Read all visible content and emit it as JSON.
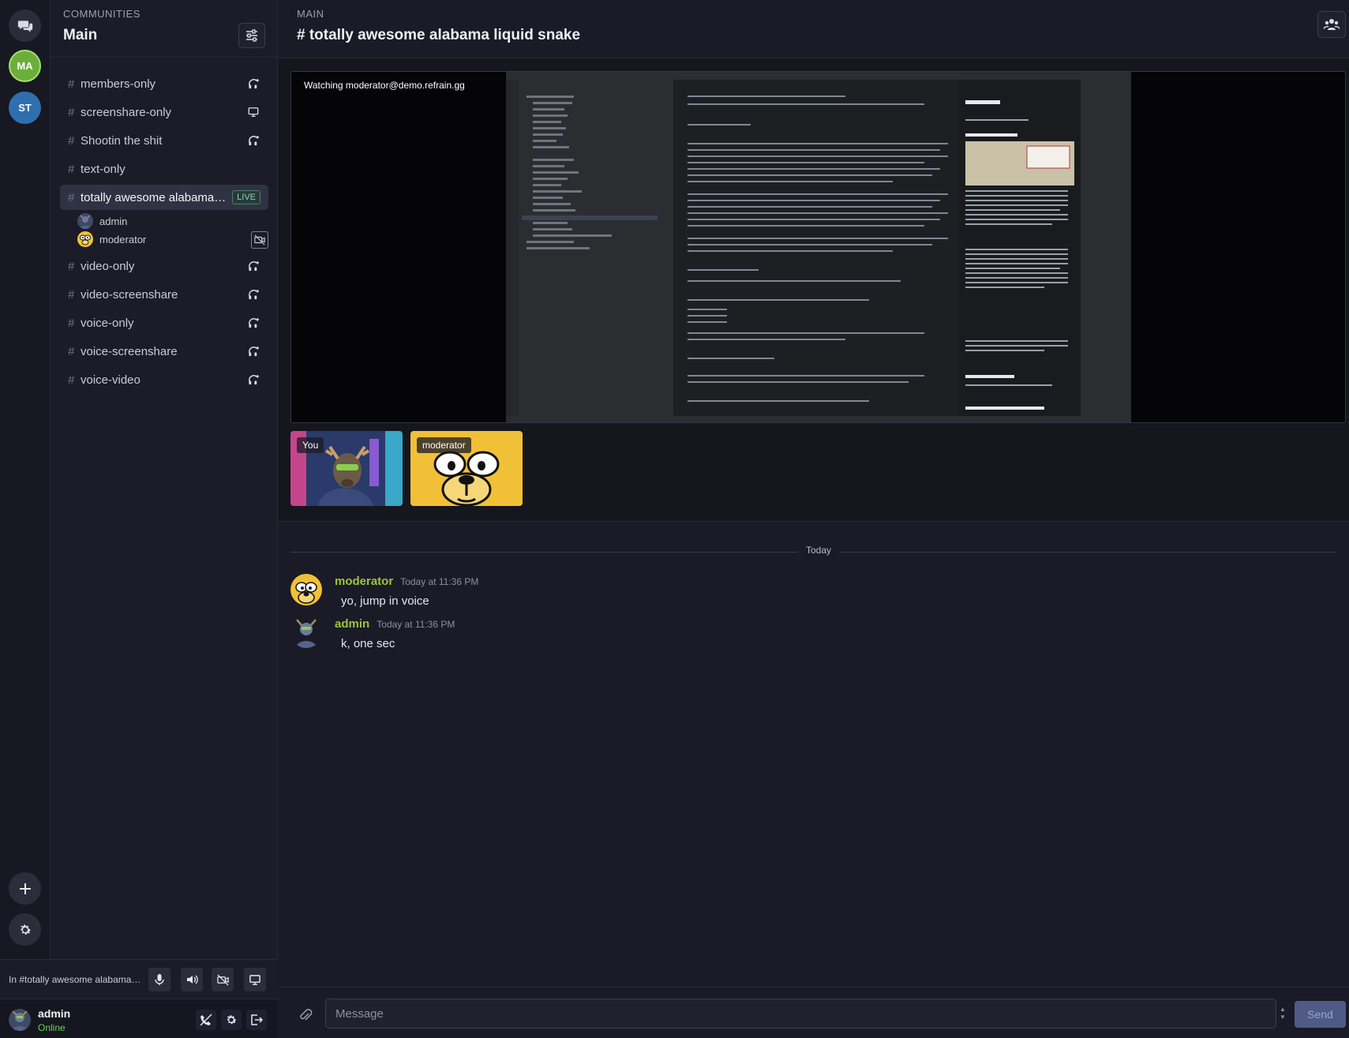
{
  "communities": {
    "label": "COMMUNITIES",
    "items": [
      {
        "initials": "MA",
        "color": "#6cae3a"
      },
      {
        "initials": "ST",
        "color": "#2f6fae"
      }
    ]
  },
  "sidebar": {
    "community_name": "Main",
    "channels": [
      {
        "name": "members-only",
        "icon": "headset-add-icon"
      },
      {
        "name": "screenshare-only",
        "icon": "monitor-icon"
      },
      {
        "name": "Shootin the shit",
        "icon": "headset-add-icon"
      },
      {
        "name": "text-only",
        "icon": ""
      },
      {
        "name": "totally awesome alabama liquid snake",
        "icon": "",
        "badge": "LIVE",
        "active": true
      },
      {
        "name": "video-only",
        "icon": "headset-add-icon"
      },
      {
        "name": "video-screenshare",
        "icon": "headset-add-icon"
      },
      {
        "name": "voice-only",
        "icon": "headset-add-icon"
      },
      {
        "name": "voice-screenshare",
        "icon": "headset-add-icon"
      },
      {
        "name": "voice-video",
        "icon": "headset-add-icon"
      }
    ],
    "voice_members": [
      {
        "name": "admin"
      },
      {
        "name": "moderator"
      }
    ]
  },
  "voice_status": {
    "text": "In #totally awesome alabama liquid snake"
  },
  "user": {
    "name": "admin",
    "status": "Online"
  },
  "main": {
    "kicker": "MAIN",
    "channel_title": "# totally awesome alabama liquid snake",
    "stream": {
      "watching_text": "Watching moderator@demo.refrain.gg"
    },
    "participants": [
      {
        "label": "You"
      },
      {
        "label": "moderator"
      }
    ],
    "divider_label": "Today",
    "messages": [
      {
        "author": "moderator",
        "time": "Today at 11:36 PM",
        "text": "yo, jump in voice"
      },
      {
        "author": "admin",
        "time": "Today at 11:36 PM",
        "text": "k, one sec"
      }
    ],
    "composer": {
      "placeholder": "Message",
      "send_label": "Send"
    }
  },
  "colors": {
    "accent_green": "#9bc53d",
    "online": "#6fcf5a",
    "live_badge": "#8fd0b8",
    "moderator_yellow": "#f2c037"
  }
}
